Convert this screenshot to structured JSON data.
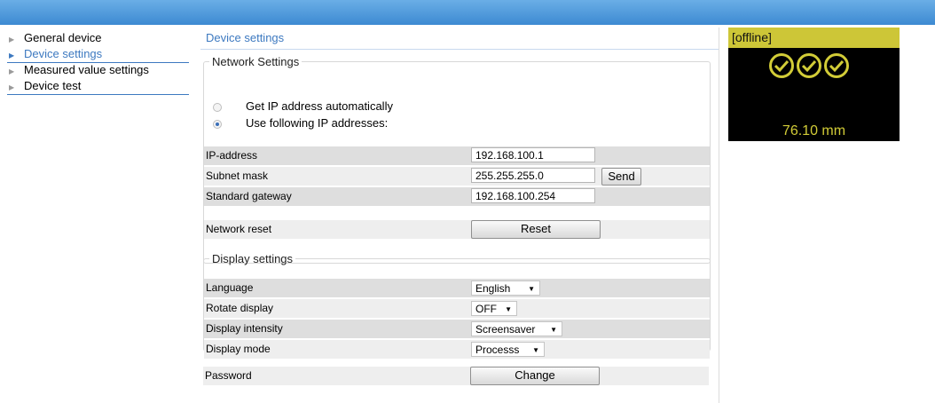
{
  "sidebar": {
    "items": [
      {
        "label": "General device"
      },
      {
        "label": "Device settings"
      },
      {
        "label": "Measured value settings"
      },
      {
        "label": "Device test"
      }
    ]
  },
  "main": {
    "title": "Device settings",
    "network": {
      "legend": "Network Settings",
      "radio_auto": "Get IP address automatically",
      "radio_manual": "Use following IP addresses:",
      "selected": "manual",
      "ip_label": "IP-address",
      "ip_value": "192.168.100.1",
      "subnet_label": "Subnet mask",
      "subnet_value": "255.255.255.0",
      "send_label": "Send",
      "gateway_label": "Standard gateway",
      "gateway_value": "192.168.100.254",
      "reset_row_label": "Network reset",
      "reset_label": "Reset"
    },
    "display": {
      "legend": "Display settings",
      "language_label": "Language",
      "language_value": "English",
      "rotate_label": "Rotate display",
      "rotate_value": "OFF",
      "intensity_label": "Display intensity",
      "intensity_value": "Screensaver",
      "mode_label": "Display mode",
      "mode_value": "Processs"
    },
    "password": {
      "label": "Password",
      "change_label": "Change"
    }
  },
  "status": {
    "state": "[offline]",
    "value": "76.10 mm",
    "check_count": 3,
    "colors": {
      "bar": "#cdc637",
      "accent": "#d2cc37",
      "background": "#000000"
    }
  },
  "colors": {
    "topbar": "#4a95db",
    "link": "#3d79c0"
  }
}
